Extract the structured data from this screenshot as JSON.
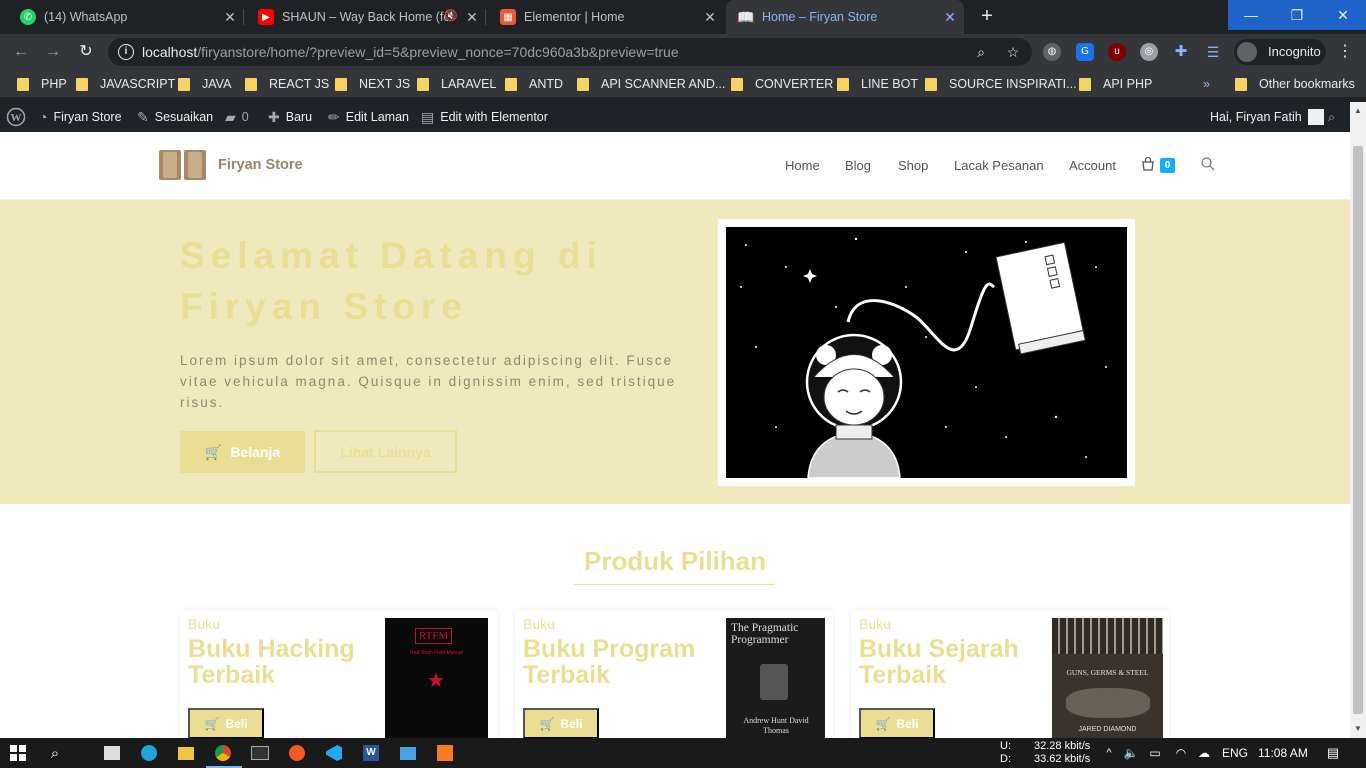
{
  "browser": {
    "tabs": [
      {
        "label": "(14) WhatsApp",
        "icon": "whatsapp-icon"
      },
      {
        "label": "SHAUN – Way Back Home (fe",
        "icon": "youtube-icon"
      },
      {
        "label": "Elementor | Home",
        "icon": "elementor-icon"
      },
      {
        "label": "Home – Firyan Store",
        "icon": "book-icon"
      }
    ],
    "url_host": "localhost",
    "url_path": "/firyanstore/home/?preview_id=5&preview_nonce=70dc960a3b&preview=true",
    "profile_label": "Incognito",
    "bookmarks": [
      "PHP",
      "JAVASCRIPT",
      "JAVA",
      "REACT JS",
      "NEXT JS",
      "LARAVEL",
      "ANTD",
      "API SCANNER AND...",
      "CONVERTER",
      "LINE BOT",
      "SOURCE INSPIRATI...",
      "API PHP"
    ],
    "other_bookmarks": "Other bookmarks"
  },
  "wp_admin": {
    "site_name": "Firyan Store",
    "customize": "Sesuaikan",
    "comments": "0",
    "new": "Baru",
    "edit_page": "Edit Laman",
    "edit_elementor": "Edit with Elementor",
    "greeting": "Hai, Firyan Fatih"
  },
  "site": {
    "logo_text": "Firyan Store",
    "menu": [
      "Home",
      "Blog",
      "Shop",
      "Lacak Pesanan",
      "Account"
    ],
    "cart_count": "0"
  },
  "hero": {
    "title": "Selamat Datang di Firyan Store",
    "description": "Lorem ipsum dolor sit amet, consectetur adipiscing elit. Fusce vitae vehicula magna. Quisque in dignissim enim, sed tristique risus.",
    "btn_primary": "Belanja",
    "btn_secondary": "Lihat Lainnya"
  },
  "products": {
    "section_title": "Produk Pilihan",
    "items": [
      {
        "category": "Buku",
        "name": "Buku Hacking Terbaik",
        "buy": "Beli",
        "cover_title": "RTFM",
        "cover_subtitle": "Red Team Field Manual"
      },
      {
        "category": "Buku",
        "name": "Buku Program Terbaik",
        "buy": "Beli",
        "cover_title": "The Pragmatic Programmer",
        "cover_subtitle": "Andrew Hunt David Thomas"
      },
      {
        "category": "Buku",
        "name": "Buku Sejarah Terbaik",
        "buy": "Beli",
        "cover_title": "GUNS, GERMS & STEEL",
        "cover_subtitle": "JARED DIAMOND"
      }
    ]
  },
  "taskbar": {
    "upload_label": "U:",
    "download_label": "D:",
    "upload_speed": "32.28 kbit/s",
    "download_speed": "33.62 kbit/s",
    "language": "ENG",
    "time": "11:08 AM"
  },
  "colors": {
    "accent": "#e9de93",
    "hero_bg": "#f0e9bd",
    "cart_badge": "#13aff0",
    "wp_bar": "#1d2327",
    "chrome_dark": "#202124"
  }
}
